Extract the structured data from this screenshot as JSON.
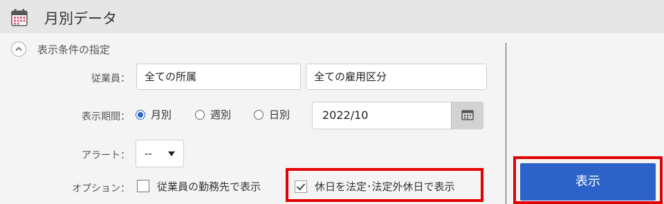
{
  "header": {
    "title": "月別データ",
    "icon": "calendar-icon"
  },
  "section": {
    "title": "表示条件の指定",
    "toggle_icon": "chevron-up-icon"
  },
  "form": {
    "employee_label": "従業員：",
    "department_value": "全ての所属",
    "employment_type_value": "全ての雇用区分",
    "period_label": "表示期間：",
    "period_options": [
      {
        "label": "月別",
        "selected": true
      },
      {
        "label": "週別",
        "selected": false
      },
      {
        "label": "日別",
        "selected": false
      }
    ],
    "date_value": "2022/10",
    "alert_label": "アラート：",
    "alert_value": "--",
    "option_label": "オプション：",
    "option_workplace": {
      "label": "従業員の勤務先で表示",
      "checked": false
    },
    "option_holiday": {
      "label": "休日を法定･法定外休日で表示",
      "checked": true
    }
  },
  "actions": {
    "show_label": "表示"
  },
  "colors": {
    "accent": "#2d63c8",
    "highlight": "#e50000",
    "header_bg": "#e6e6e6"
  }
}
